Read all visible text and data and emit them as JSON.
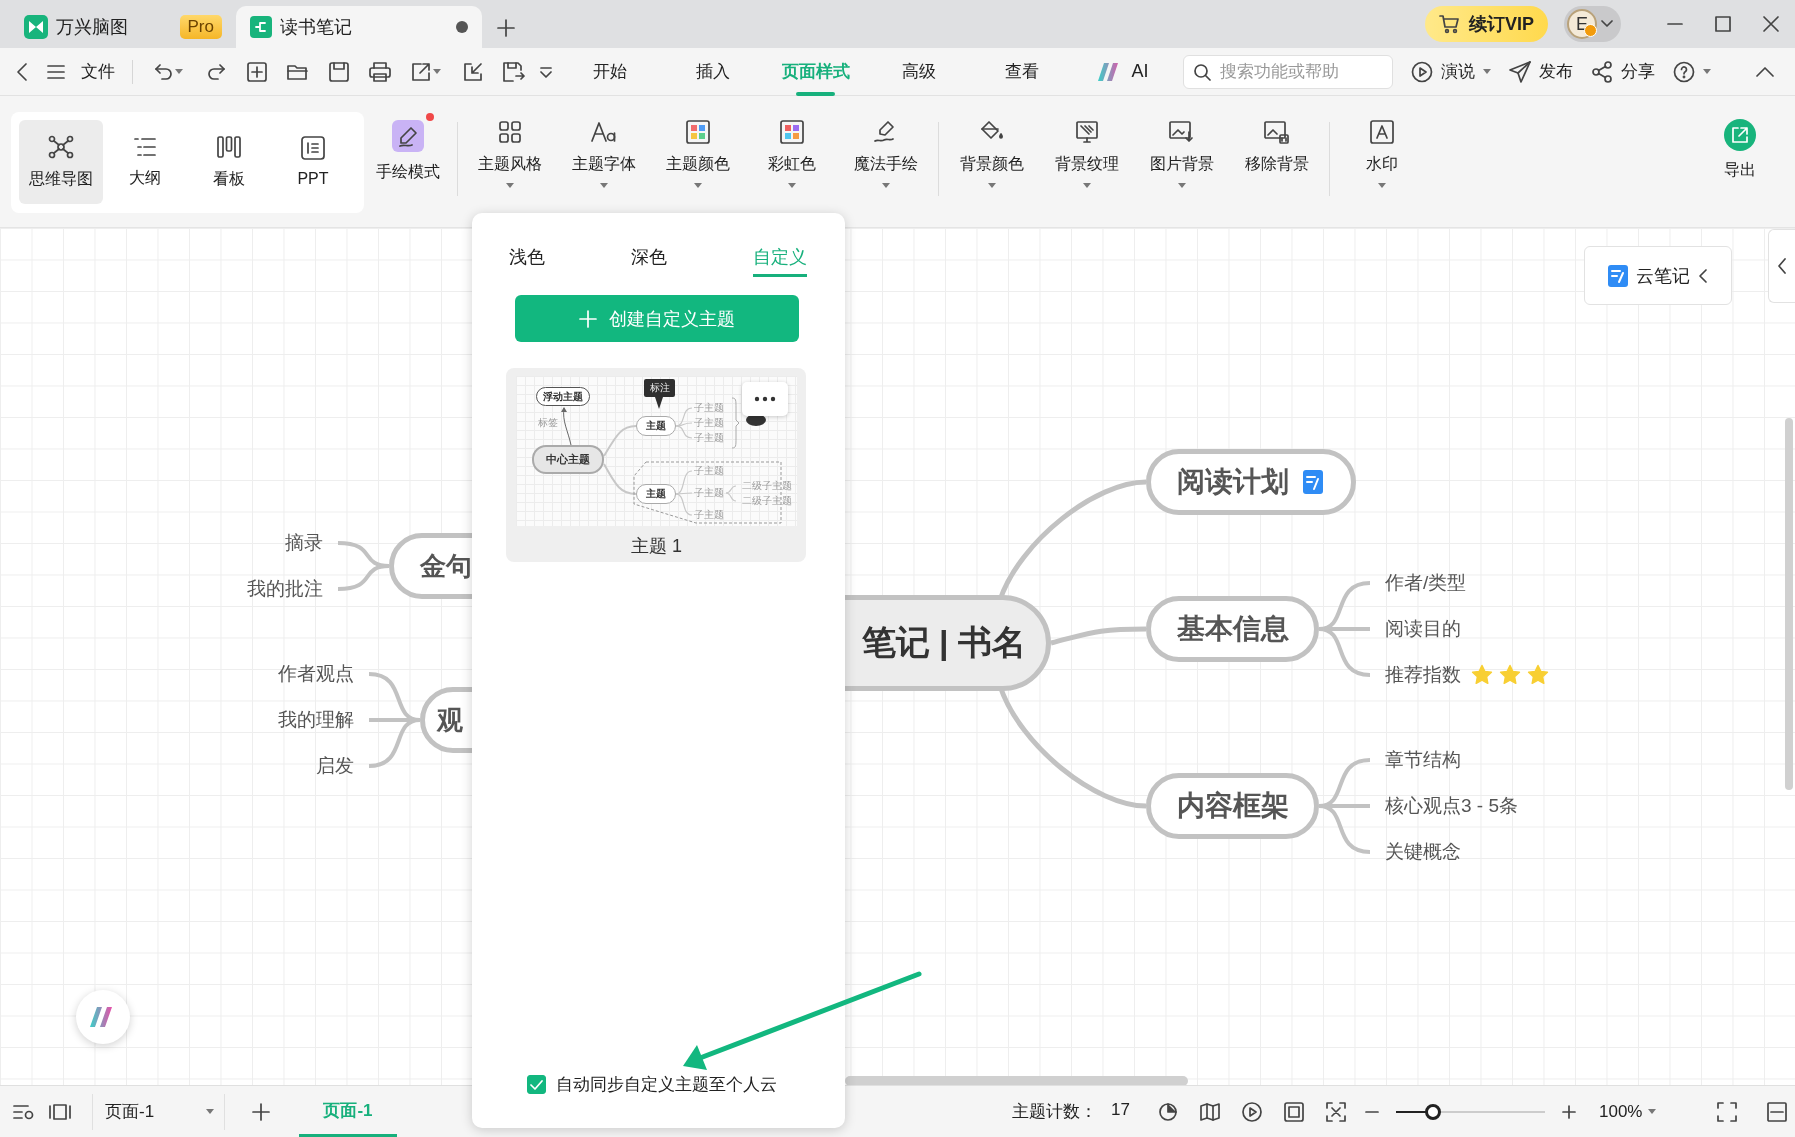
{
  "title_bar": {
    "tabs": [
      {
        "kind": "app",
        "label": "万兴脑图",
        "badge": "Pro",
        "selected": false
      },
      {
        "kind": "document",
        "label": "读书笔记",
        "unsaved": true,
        "selected": true
      }
    ],
    "vip_button": "续订VIP",
    "avatar": "E"
  },
  "menu_bar": {
    "file": "文件",
    "tabs": [
      {
        "label": "开始",
        "selected": false
      },
      {
        "label": "插入",
        "selected": false
      },
      {
        "label": "页面样式",
        "selected": true
      },
      {
        "label": "高级",
        "selected": false
      },
      {
        "label": "查看",
        "selected": false
      }
    ],
    "ai": "AI",
    "search": {
      "placeholder": "搜索功能或帮助"
    },
    "actions": [
      {
        "label": "演说",
        "dropdown": true
      },
      {
        "label": "发布",
        "dropdown": false
      },
      {
        "label": "分享",
        "dropdown": false
      }
    ]
  },
  "ribbon": {
    "views": [
      {
        "label": "思维导图",
        "selected": true
      },
      {
        "label": "大纲",
        "selected": false
      },
      {
        "label": "看板",
        "selected": false
      },
      {
        "label": "PPT",
        "selected": false
      }
    ],
    "hand_drawn": {
      "label": "手绘模式",
      "new_dot": true
    },
    "groups": [
      [
        {
          "label": "主题风格",
          "dropdown": true
        },
        {
          "label": "主题字体",
          "dropdown": true
        },
        {
          "label": "主题颜色",
          "dropdown": true
        },
        {
          "label": "彩虹色",
          "dropdown": true
        },
        {
          "label": "魔法手绘",
          "dropdown": true
        }
      ],
      [
        {
          "label": "背景颜色",
          "dropdown": true
        },
        {
          "label": "背景纹理",
          "dropdown": true
        },
        {
          "label": "图片背景",
          "dropdown": true
        },
        {
          "label": "移除背景",
          "dropdown": false
        }
      ],
      [
        {
          "label": "水印",
          "dropdown": true
        }
      ]
    ],
    "export": "导出"
  },
  "canvas": {
    "mind_map": {
      "central": "笔记 | 书名",
      "right": [
        {
          "label": "阅读计划",
          "note": true
        },
        {
          "label": "基本信息",
          "note": false,
          "children": [
            {
              "label": "作者/类型"
            },
            {
              "label": "阅读目的"
            },
            {
              "label": "推荐指数",
              "stars": 3
            }
          ]
        },
        {
          "label": "内容框架",
          "note": false,
          "children": [
            {
              "label": "章节结构"
            },
            {
              "label": "核心观点3 - 5条"
            },
            {
              "label": "关键概念"
            }
          ]
        }
      ],
      "left": [
        {
          "label": "金句",
          "children": [
            {
              "label": "摘录"
            },
            {
              "label": "我的批注"
            }
          ]
        },
        {
          "label": "观",
          "children": [
            {
              "label": "作者观点"
            },
            {
              "label": "我的理解"
            },
            {
              "label": "启发"
            }
          ]
        }
      ]
    },
    "cloud_notes": "云笔记"
  },
  "theme_panel": {
    "tabs": [
      {
        "label": "浅色",
        "selected": false
      },
      {
        "label": "深色",
        "selected": false
      },
      {
        "label": "自定义",
        "selected": true
      }
    ],
    "create_button": "创建自定义主题",
    "themes": [
      {
        "name": "主题 1",
        "preview": {
          "float_topic": "浮动主题",
          "tag": "标签",
          "callout": "标注",
          "central": "中心主题",
          "branches": [
            {
              "label": "主题",
              "children": [
                {
                  "label": "子主题"
                },
                {
                  "label": "子主题"
                },
                {
                  "label": "子主题"
                }
              ]
            },
            {
              "label": "主题",
              "children": [
                {
                  "label": "子主题"
                },
                {
                  "label": "子主题",
                  "children": [
                    {
                      "label": "二级子主题"
                    },
                    {
                      "label": "二级子主题"
                    }
                  ]
                },
                {
                  "label": "子主题"
                }
              ]
            }
          ]
        }
      }
    ],
    "sync": {
      "label": "自动同步自定义主题至个人云",
      "checked": true
    }
  },
  "status_bar": {
    "page_select": "页面-1",
    "pages": [
      {
        "label": "页面-1",
        "selected": true
      }
    ],
    "topic_count_label": "主题计数：",
    "topic_count": "17",
    "zoom": {
      "level": 0.25,
      "reading": "100%"
    }
  }
}
